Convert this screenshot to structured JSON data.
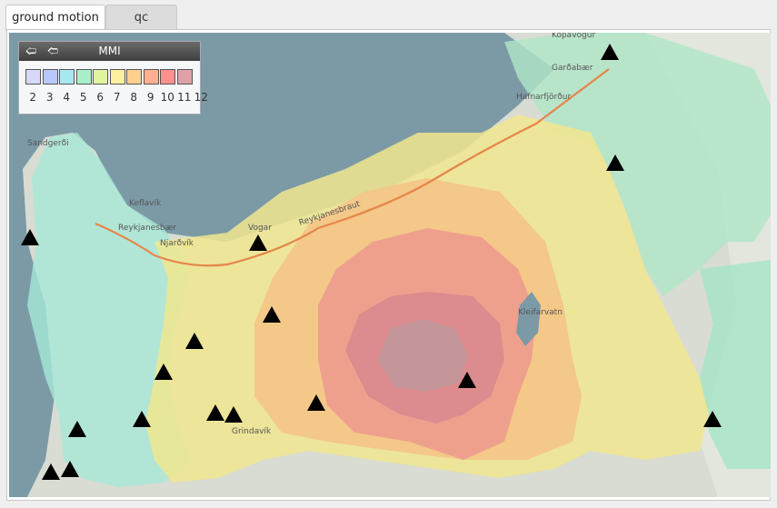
{
  "tabs": [
    {
      "label": "ground motion",
      "active": true
    },
    {
      "label": "qc",
      "active": false
    }
  ],
  "legend": {
    "title": "MMI",
    "prev_icon": "left-arrow-icon",
    "next_icon": "right-arrow-icon",
    "levels": [
      {
        "label": "2",
        "color": "#d8d8f8"
      },
      {
        "label": "3",
        "color": "#b8c8ff"
      },
      {
        "label": "4",
        "color": "#a8e8f0"
      },
      {
        "label": "5",
        "color": "#a8f0c8"
      },
      {
        "label": "6",
        "color": "#e0f4a0"
      },
      {
        "label": "7",
        "color": "#fff0a0"
      },
      {
        "label": "8",
        "color": "#ffd090"
      },
      {
        "label": "9",
        "color": "#ffb090"
      },
      {
        "label": "10",
        "color": "#ff9090"
      },
      {
        "label": "11",
        "color": "#e0a0a8"
      },
      {
        "label": "12",
        "color": "#c09898"
      }
    ]
  },
  "map": {
    "places": [
      "Kópavogur",
      "Garðabær",
      "Hafnarfjörður",
      "Sandgerði",
      "Keflavík",
      "Reykjanesbær",
      "Njarðvík",
      "Vogar",
      "Reykjanesbraut",
      "Kleifarvatn",
      "Grindavík"
    ],
    "station_icon": "station-triangle-icon",
    "colors": {
      "sea": "#7b9aa6",
      "land": "#d6dcd0"
    }
  }
}
